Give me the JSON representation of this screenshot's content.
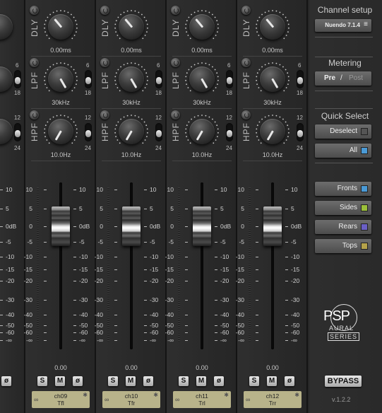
{
  "channels": [
    {
      "name": "ch09",
      "speaker": "Tfl",
      "dly_value": "0.00ms",
      "lpf_value": "30kHz",
      "hpf_value": "10.0Hz",
      "fader_value": "0.00"
    },
    {
      "name": "ch10",
      "speaker": "Tfr",
      "dly_value": "0.00ms",
      "lpf_value": "30kHz",
      "hpf_value": "10.0Hz",
      "fader_value": "0.00"
    },
    {
      "name": "ch11",
      "speaker": "Trl",
      "dly_value": "0.00ms",
      "lpf_value": "30kHz",
      "hpf_value": "10.0Hz",
      "fader_value": "0.00"
    },
    {
      "name": "ch12",
      "speaker": "Trr",
      "dly_value": "0.00ms",
      "lpf_value": "30kHz",
      "hpf_value": "10.0Hz",
      "fader_value": "0.00"
    }
  ],
  "strip_labels": {
    "dly": "DLY",
    "lpf": "LPF",
    "hpf": "HPF",
    "lpf_slope_top": "6",
    "lpf_slope_bottom": "18",
    "hpf_slope_top": "12",
    "hpf_slope_bottom": "24"
  },
  "buttons": {
    "solo": "S",
    "mute": "M",
    "phase": "ø"
  },
  "fader_scale": [
    "10",
    "5",
    "0dB",
    "-5",
    "-10",
    "-15",
    "-20",
    "-30",
    "-40",
    "-50",
    "-60",
    "-∞"
  ],
  "fader_scale_left": [
    "10",
    "5",
    "0",
    "-5",
    "-10",
    "-15",
    "-20",
    "-30",
    "-40",
    "-50",
    "-60",
    "-∞"
  ],
  "right_panel": {
    "channel_setup_title": "Channel setup",
    "channel_setup_value": "Nuendo 7.1.4",
    "metering_title": "Metering",
    "metering_pre": "Pre",
    "metering_sep": "/",
    "metering_post": "Post",
    "quick_select_title": "Quick Select",
    "deselect": "Deselect",
    "all": "All",
    "fronts": "Fronts",
    "sides": "Sides",
    "rears": "Rears",
    "tops": "Tops",
    "logo_text": "PSP",
    "logo_sub1": "AURAL",
    "logo_sub2": "SERIES",
    "bypass": "BYPASS",
    "version": "v.1.2.2"
  },
  "colors": {
    "fronts": "#4a9ad6",
    "sides": "#9bbf3a",
    "rears": "#6a5fc4",
    "tops": "#b5a24a",
    "all": "#4a9ad6",
    "name_plate": "#b8b38a"
  }
}
